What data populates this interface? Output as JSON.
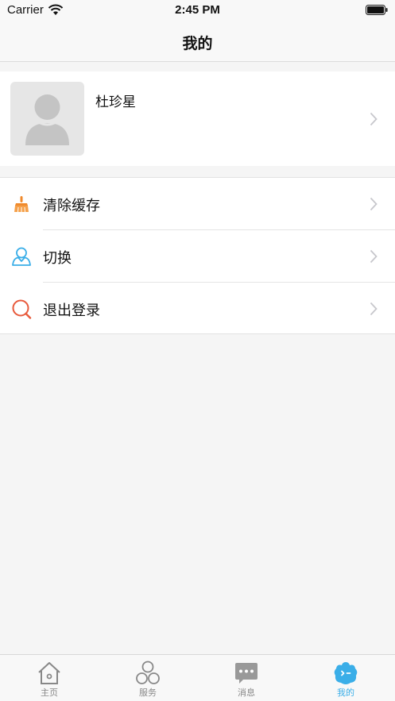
{
  "status_bar": {
    "carrier": "Carrier",
    "time": "2:45 PM"
  },
  "nav": {
    "title": "我的"
  },
  "profile": {
    "name": "杜珍星"
  },
  "menu": {
    "items": [
      {
        "label": "清除缓存",
        "icon": "broom-icon",
        "color": "#f08a2c"
      },
      {
        "label": "切换",
        "icon": "user-switch-icon",
        "color": "#3aaee8"
      },
      {
        "label": "退出登录",
        "icon": "logout-icon",
        "color": "#e85a3c"
      }
    ]
  },
  "tabs": [
    {
      "label": "主页",
      "icon": "home-icon",
      "active": false
    },
    {
      "label": "服务",
      "icon": "services-icon",
      "active": false
    },
    {
      "label": "消息",
      "icon": "message-icon",
      "active": false
    },
    {
      "label": "我的",
      "icon": "profile-icon",
      "active": true
    }
  ],
  "colors": {
    "accent": "#3aaee8",
    "background": "#f5f5f5",
    "inactive": "#888888"
  }
}
